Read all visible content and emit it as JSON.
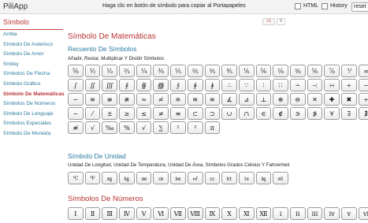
{
  "app": {
    "brand": "PiliApp",
    "hint": "Haga clic en botón de símbolo para copiar al Portapapeles",
    "html_label": "HTML",
    "history_label": "History",
    "reset_label": "reset"
  },
  "social": {
    "plus_label": "+1",
    "count": "0"
  },
  "sidebar": {
    "heading": "Símbolo",
    "items": [
      {
        "label": "Arriba",
        "active": false
      },
      {
        "label": "Símbolo De Asterisco",
        "active": false
      },
      {
        "label": "Símbolo De Amor",
        "active": false
      },
      {
        "label": "Smiley",
        "active": false
      },
      {
        "label": "Símbolos De Flecha",
        "active": false
      },
      {
        "label": "Símbolo Gráfico",
        "active": false
      },
      {
        "label": "Símbolo De Matemáticas",
        "active": true
      },
      {
        "label": "Símbolos De Números",
        "active": false
      },
      {
        "label": "Símbolo De Lenguaje",
        "active": false
      },
      {
        "label": "Símbolos Especiales",
        "active": false
      },
      {
        "label": "Símbolo De Moneda",
        "active": false
      }
    ]
  },
  "main": {
    "title": "Símbolo De Matemáticas",
    "sections": [
      {
        "title": "Recuento De Símbolos",
        "subtitle": "Añadir, Restar, Multiplicar Y Dividir Símbolos",
        "keys": [
          "⅝",
          "½",
          "⅓",
          "⅔",
          "¼",
          "¾",
          "⅕",
          "⅖",
          "⅗",
          "⅘",
          "⅙",
          "⅚",
          "⅛",
          "⅜",
          "⅝",
          "⅞",
          "⅟",
          "∞",
          "∫",
          "∬",
          "∭",
          "∮",
          "∯",
          "∰",
          "∱",
          "∲",
          "∳",
          "∴",
          "∵",
          "∶",
          "∷",
          "∸",
          "∹",
          "∺",
          "∻",
          "∼",
          "∽",
          "≅",
          "≆",
          "≇",
          "≈",
          "≉",
          "≊",
          "≋",
          "≌",
          "∡",
          "⊿",
          "⊥",
          "⊕",
          "⊖",
          "✕",
          "✚",
          "✖",
          "÷",
          "−",
          "⁄",
          "±",
          "≥",
          "≤",
          "≠",
          "≡",
          "⊂",
          "⊃",
          "∪",
          "∩",
          "∈",
          "∉",
          "∋",
          "∌",
          "∀",
          "∃",
          "∄",
          "≢",
          "√",
          "‰",
          "%",
          "√",
          "∑",
          "²",
          "³",
          "π"
        ]
      },
      {
        "title": "Símbolo De Unidad",
        "subtitle": "Unidad De Longitud, Unidad De Temperatura, Unidad De Área, Símbolos Grados Celsius Y Fahrenheit",
        "keys": [
          "℃",
          "℉",
          "㎎",
          "㎏",
          "㎜",
          "㎝",
          "㎞",
          "㎡",
          "㏄",
          "㏏",
          "㏑",
          "㏒",
          "㏕"
        ]
      },
      {
        "title": "Símbolos De Números",
        "keys": [
          "Ⅰ",
          "Ⅱ",
          "Ⅲ",
          "Ⅳ",
          "Ⅴ",
          "Ⅵ",
          "Ⅶ",
          "Ⅷ",
          "Ⅸ",
          "Ⅹ",
          "Ⅺ",
          "Ⅻ",
          "ⅰ",
          "ⅱ",
          "ⅲ",
          "ⅳ",
          "ⅴ",
          "ⅵ"
        ]
      }
    ]
  }
}
